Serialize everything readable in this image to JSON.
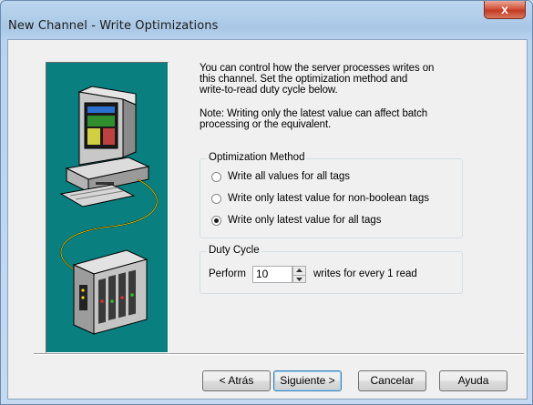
{
  "window": {
    "title": "New Channel - Write Optimizations",
    "close_glyph": "x"
  },
  "description": {
    "lines": [
      "You can control how the server processes writes on",
      "this channel.  Set the optimization method and",
      "write-to-read duty cycle below."
    ],
    "note_lines": [
      "Note:  Writing only the latest value can affect batch",
      "processing or the equivalent."
    ]
  },
  "optimization": {
    "legend": "Optimization Method",
    "options": [
      {
        "label": "Write all values for all tags",
        "selected": false
      },
      {
        "label": "Write only latest value for non-boolean tags",
        "selected": false
      },
      {
        "label": "Write only latest value for all tags",
        "selected": true
      }
    ]
  },
  "duty_cycle": {
    "legend": "Duty Cycle",
    "prefix": "Perform",
    "value": "10",
    "suffix": "writes for every 1 read"
  },
  "buttons": {
    "back": "< Atrás",
    "next": "Siguiente >",
    "cancel": "Cancelar",
    "help": "Ayuda"
  },
  "colors": {
    "illustration_bg": "#0a7f7f",
    "close_button": "#c33b22"
  }
}
